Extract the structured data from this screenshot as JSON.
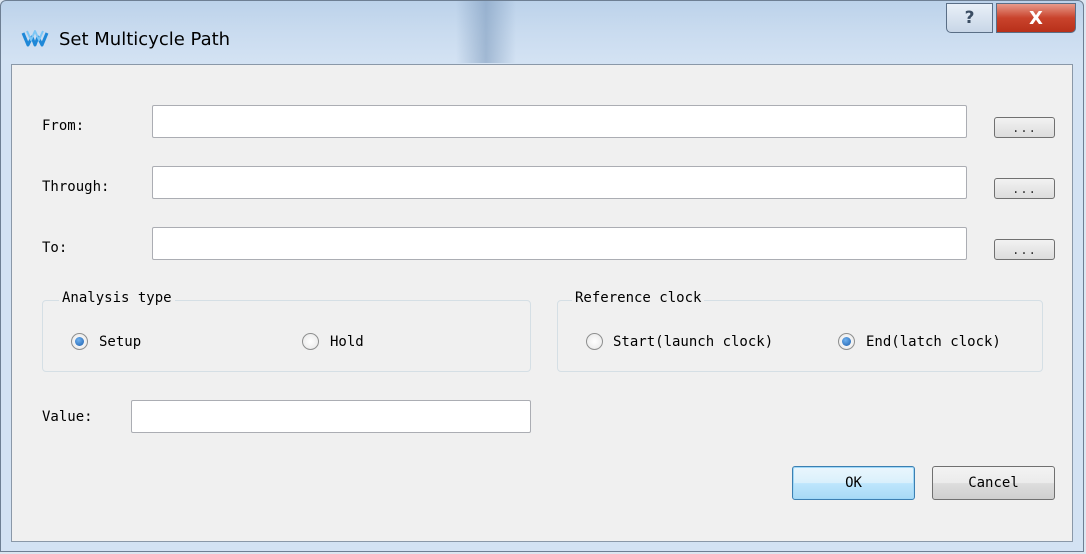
{
  "window": {
    "title": "Set Multicycle Path",
    "help_label": "?",
    "close_label": "X"
  },
  "fields": {
    "from": {
      "label": "From:",
      "value": "",
      "browse_label": "..."
    },
    "through": {
      "label": "Through:",
      "value": "",
      "browse_label": "..."
    },
    "to": {
      "label": "To:",
      "value": "",
      "browse_label": "..."
    },
    "value": {
      "label": "Value:",
      "value": ""
    }
  },
  "analysis_type": {
    "title": "Analysis type",
    "options": [
      {
        "label": "Setup",
        "selected": true
      },
      {
        "label": "Hold",
        "selected": false
      }
    ]
  },
  "reference_clock": {
    "title": "Reference clock",
    "options": [
      {
        "label": "Start(launch clock)",
        "selected": false
      },
      {
        "label": "End(latch clock)",
        "selected": true
      }
    ]
  },
  "buttons": {
    "ok": "OK",
    "cancel": "Cancel"
  },
  "colors": {
    "titlebar": "#c9dbef",
    "client_bg": "#f0f0f0",
    "close_red": "#c9432c",
    "radio_selected": "#1d5fae",
    "default_button": "#bee6fd"
  }
}
